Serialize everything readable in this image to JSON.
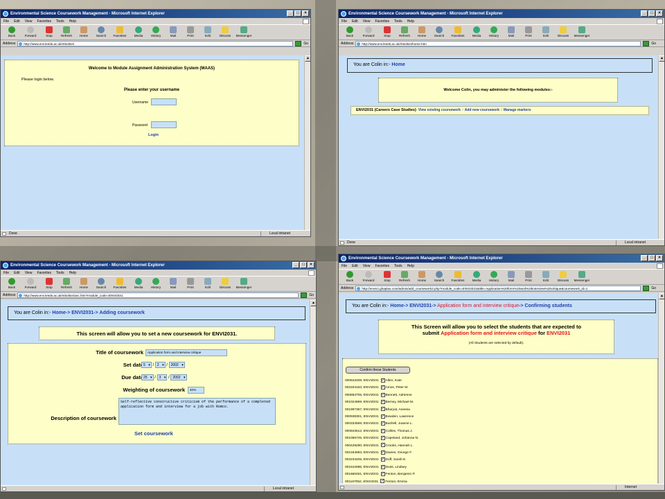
{
  "windows": {
    "title": "Environmental Science Coursework Management - Microsoft Internet Explorer",
    "title_short": "Environmental Science Coursework Management - Microsoft Internet Explorer",
    "menu": [
      "File",
      "Edit",
      "View",
      "Favorites",
      "Tools",
      "Help"
    ],
    "toolbar": [
      "Back",
      "Forward",
      "Stop",
      "Refresh",
      "Home",
      "Search",
      "Favorites",
      "Media",
      "History",
      "Mail",
      "Print",
      "Edit",
      "Discuss",
      "Messenger"
    ],
    "address_label": "Address",
    "go_label": "Go"
  },
  "w1": {
    "url": "http://www.env.leeds.ac.uk/mbolton/",
    "heading": "Welcome to Module Assignment Administration System (MAAS)",
    "prompt": "Please login below.",
    "enter": "Please enter your username",
    "username_label": "Username",
    "password_label": "Password",
    "login": "Login",
    "status": "Done",
    "zone": "Local intranet"
  },
  "w2": {
    "url": "http://www.env.leeds.ac.uk/mbolton/home.htm",
    "crumb_prefix": "You are Colin in:-",
    "crumb_home": "Home",
    "welcome": "Welcome Colin, you may administer the following modules:-",
    "module": "ENVI2031 (Careers Case Studies)",
    "view_link": "View existing coursework",
    "sep1": "::",
    "add_link": "Add new coursework",
    "sep2": "::",
    "markers_link": "Manage markers",
    "status": "Done",
    "zone": "Local intranet"
  },
  "w3": {
    "url": "http://www.env.leeds.ac.uk/mbolton/anc.htm?module_code=ENVI2031",
    "crumb_prefix": "You are Colin in:-",
    "crumb_home": "Home",
    "crumb_module": "ENVI2031",
    "crumb_page": "Adding coursework",
    "arrow": "->",
    "intro": "This screen will allow you to set a new coursework for ENVI2031.",
    "title_label": "Title of coursework",
    "title_value": "Application form and interview critique",
    "set_label": "Set date",
    "set_day": "5",
    "set_month": "2",
    "set_year": "2002",
    "due_label": "Due date",
    "due_day": "25",
    "due_month": "3",
    "due_year": "2002",
    "slash": "/",
    "weight_label": "Weighting of coursework",
    "weight_value": "40%",
    "desc_label": "Description of coursework",
    "desc_value": "Self-reflective constructive criticism of the performance of a completed application form and interview for a job with Romco.",
    "submit": "Set coursework",
    "zone": "Local intranet"
  },
  "w4": {
    "url": "http://envsci.ghaplau.com/admin/add_coursework2.php?module_code=ENVI2031&title=Application%20form%20and%20interview%20critique&coursework_id=1",
    "crumb_prefix": "You are Colin in:-",
    "crumb_home": "Home",
    "crumb_module": "ENVI2031",
    "crumb_cw": "Application form and interview critique",
    "crumb_page": "Confirming students",
    "arrow": "->",
    "intro_a": "This Screen will allow you to select the students that are expected to",
    "intro_b": "submit",
    "intro_cw": "Application form and interview critique",
    "intro_for": "for",
    "intro_mod": "ENVI2031",
    "note": "(All Students are selected by default).",
    "confirm_btn": "Confirm these Students",
    "students": [
      {
        "id": "000943408, ENVI2031",
        "name": "Allen, Kate"
      },
      {
        "id": "002334163, ENVI2031",
        "name": "Amos, Peter M."
      },
      {
        "id": "000853705, ENVI2031",
        "name": "Bennett, Adrienne"
      },
      {
        "id": "001024869, ENVI2031",
        "name": "Berney, Michael M."
      },
      {
        "id": "001997367, ENVI2031",
        "name": "Bharyat, Aneesa"
      },
      {
        "id": "000938301, ENVI2031",
        "name": "Bowden, Lawrence"
      },
      {
        "id": "000334569, ENVI2031",
        "name": "Bushell, Joanne L."
      },
      {
        "id": "000943512, ENVI2031",
        "name": "Collins, Thomas J."
      },
      {
        "id": "001065725, ENVI2031",
        "name": "Copeland, Johanna N."
      },
      {
        "id": "000429290, ENVI2031",
        "name": "Crooks, Hannah L."
      },
      {
        "id": "002184993, ENVI2031",
        "name": "Davies, George F."
      },
      {
        "id": "002234405, ENVI2031",
        "name": "Duff, Sarah E."
      },
      {
        "id": "001510085, ENVI2031",
        "name": "Dunk, Lindsey"
      },
      {
        "id": "001660461, ENVI2031",
        "name": "Fenton, Benjamin P."
      },
      {
        "id": "001167052, ENVI2031",
        "name": "Fenton, Emma"
      },
      {
        "id": "001599150, ENVI2031",
        "name": "Garrett, Alexa E."
      }
    ],
    "zone": "Internet"
  }
}
